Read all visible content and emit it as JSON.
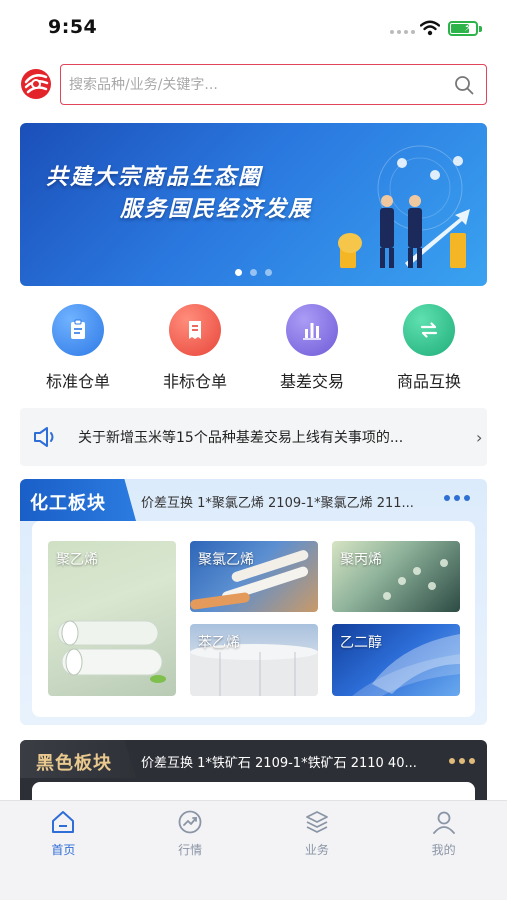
{
  "status_bar": {
    "time": "9:54"
  },
  "search": {
    "placeholder": "搜索品种/业务/关键字..."
  },
  "banner": {
    "line1": "共建大宗商品生态圈",
    "line2": "服务国民经济发展",
    "slides": 3,
    "active_slide": 1
  },
  "quick_menu": [
    {
      "label": "标准仓单",
      "icon": "clipboard-icon",
      "color": "#3f8ff0"
    },
    {
      "label": "非标仓单",
      "icon": "receipt-icon",
      "color": "#f0574a"
    },
    {
      "label": "基差交易",
      "icon": "bar-chart-icon",
      "color": "#8a78e6"
    },
    {
      "label": "商品互换",
      "icon": "swap-icon",
      "color": "#2fc08e"
    }
  ],
  "notice": {
    "text": "关于新增玉米等15个品种基差交易上线有关事项的..."
  },
  "chemical": {
    "title": "化工板块",
    "summary": "价差互换 1*聚氯乙烯 2109-1*聚氯乙烯 211...",
    "tiles": [
      "聚乙烯",
      "聚氯乙烯",
      "聚丙烯",
      "苯乙烯",
      "乙二醇"
    ]
  },
  "black": {
    "title": "黑色板块",
    "summary": "价差互换 1*铁矿石 2109-1*铁矿石 2110 40..."
  },
  "tabs": [
    {
      "label": "首页",
      "icon": "home-icon",
      "active": true
    },
    {
      "label": "行情",
      "icon": "trend-icon",
      "active": false
    },
    {
      "label": "业务",
      "icon": "layers-icon",
      "active": false
    },
    {
      "label": "我的",
      "icon": "user-icon",
      "active": false
    }
  ],
  "colors": {
    "accent": "#2f6dd8",
    "brand_red": "#e0455c",
    "gold": "#e9c98d"
  }
}
